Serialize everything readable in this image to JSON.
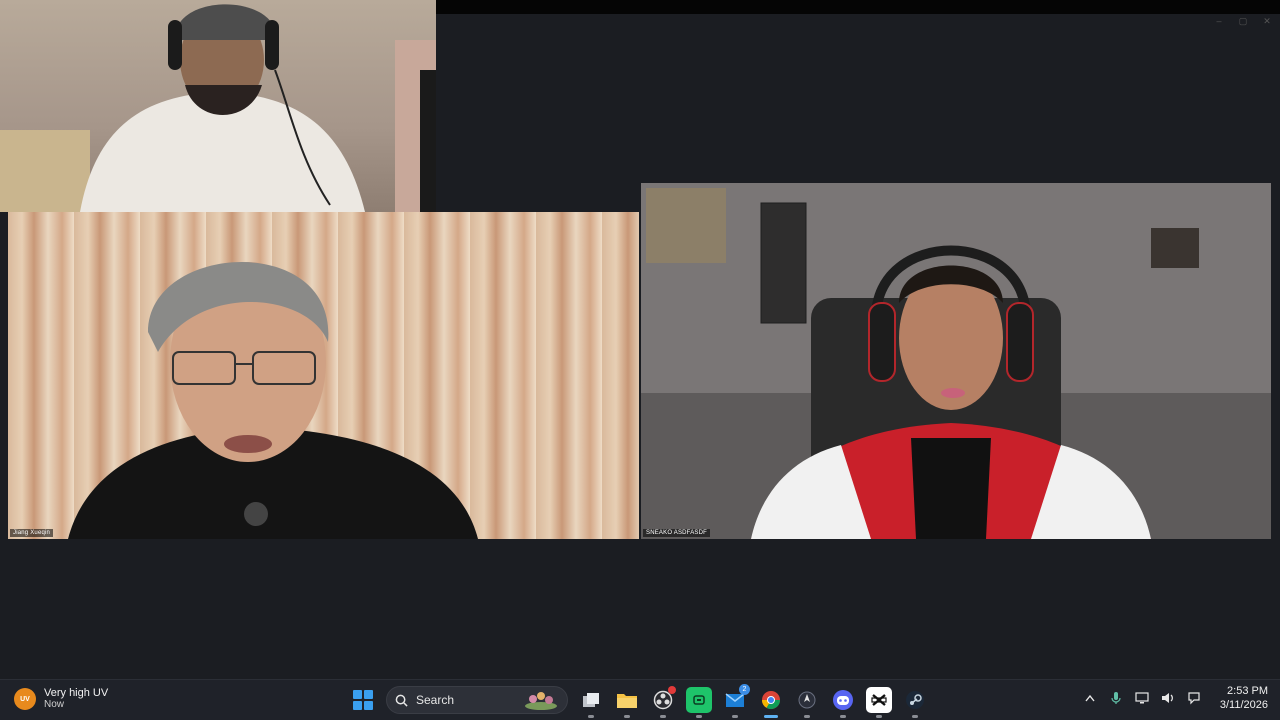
{
  "window": {
    "controls": [
      "–",
      "▢",
      "✕"
    ]
  },
  "tiles": {
    "top": {
      "label": ""
    },
    "left": {
      "label": "Jiang Xueqin"
    },
    "right": {
      "label": "SNEAKO ASDFASDF"
    }
  },
  "taskbar": {
    "weather": {
      "badge": "UV",
      "title": "Very high UV",
      "subtitle": "Now"
    },
    "search": {
      "label": "Search"
    },
    "apps": [
      {
        "name": "task-view",
        "icon": "task-view-icon"
      },
      {
        "name": "file-explorer",
        "icon": "folder-icon"
      },
      {
        "name": "obs",
        "icon": "obs-icon"
      },
      {
        "name": "app-green",
        "icon": "green-app-icon"
      },
      {
        "name": "mail",
        "icon": "mail-icon",
        "badge": "2"
      },
      {
        "name": "chrome",
        "icon": "chrome-icon",
        "active": true
      },
      {
        "name": "app-dark",
        "icon": "dark-app-icon"
      },
      {
        "name": "discord",
        "icon": "discord-icon"
      },
      {
        "name": "capcut",
        "icon": "capcut-icon"
      },
      {
        "name": "steam",
        "icon": "steam-icon"
      }
    ],
    "clock": {
      "time": "2:53 PM",
      "date": "3/11/2026"
    }
  },
  "colors": {
    "background": "#1b1d22",
    "taskbar": "#1f2229",
    "accent": "#5fb2f2",
    "uv_badge": "#e88a1d"
  }
}
